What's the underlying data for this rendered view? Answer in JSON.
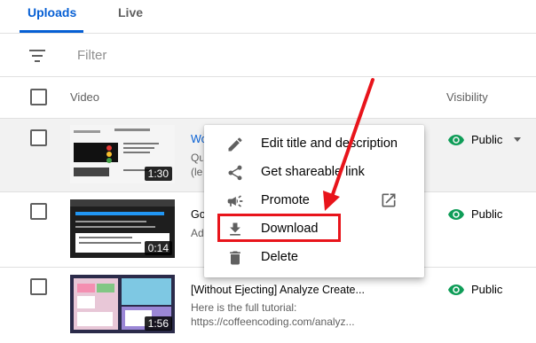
{
  "tabs": [
    {
      "label": "Uploads"
    },
    {
      "label": "Live"
    }
  ],
  "filter": {
    "placeholder": "Filter"
  },
  "columns": {
    "video": "Video",
    "visibility": "Visibility"
  },
  "rows": [
    {
      "title": "Wo",
      "desc_line1": "Qu",
      "desc_line2": "(le",
      "duration": "1:30",
      "visibility": "Public"
    },
    {
      "title": "Go",
      "desc_line1": "Ad",
      "desc_line2": "",
      "duration": "0:14",
      "visibility": "Public"
    },
    {
      "title": "[Without Ejecting] Analyze Create...",
      "desc_line1": "Here is the full tutorial:",
      "desc_line2": "https://coffeencoding.com/analyz...",
      "duration": "1:56",
      "visibility": "Public"
    }
  ],
  "menu": {
    "items": [
      {
        "label": "Edit title and description",
        "icon": "pencil-icon"
      },
      {
        "label": "Get shareable link",
        "icon": "share-icon"
      },
      {
        "label": "Promote",
        "icon": "megaphone-icon"
      },
      {
        "label": "Download",
        "icon": "download-icon"
      },
      {
        "label": "Delete",
        "icon": "trash-icon"
      }
    ]
  },
  "colors": {
    "accent": "#065fd4",
    "annotation": "#e8141b",
    "public_icon": "#0f9d58"
  }
}
